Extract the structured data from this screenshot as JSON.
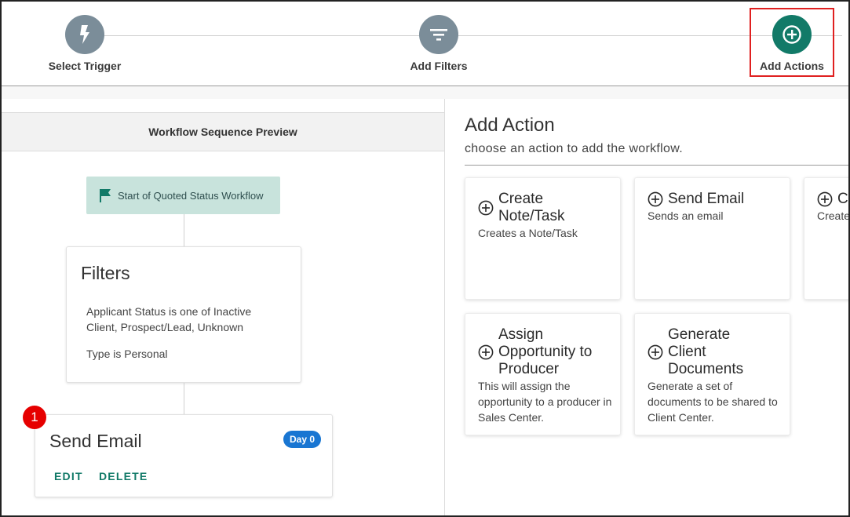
{
  "stepper": {
    "steps": [
      {
        "label": "Select Trigger",
        "icon": "lightning-bolt-icon"
      },
      {
        "label": "Add Filters",
        "icon": "filter-icon"
      },
      {
        "label": "Add Actions",
        "icon": "add-circle-icon"
      }
    ],
    "active_step": "Add Actions",
    "colors": {
      "inactive": "#7b8d99",
      "active": "#127a68",
      "highlight": "#e02020"
    }
  },
  "preview": {
    "header": "Workflow Sequence Preview",
    "start_node": {
      "label": "Start of Quoted Status Workflow",
      "icon": "flag-icon"
    },
    "filters": {
      "title": "Filters",
      "conditions": [
        "Applicant Status is one of Inactive Client, Prospect/Lead, Unknown",
        "Type is Personal"
      ]
    },
    "steps": [
      {
        "number": "1",
        "title": "Send Email",
        "day_badge": "Day 0",
        "edit_label": "EDIT",
        "delete_label": "DELETE"
      }
    ]
  },
  "add_action": {
    "title": "Add Action",
    "subtitle": "choose an action to add the workflow.",
    "cards": [
      {
        "title": "Create Note/Task",
        "description": "Creates a Note/Task"
      },
      {
        "title": "Send Email",
        "description": "Sends an email"
      },
      {
        "title": "Cr",
        "description": "Create"
      },
      {
        "title": "Assign Opportunity to Producer",
        "description": "This will assign the opportunity to a producer in Sales Center."
      },
      {
        "title": "Generate Client Documents",
        "description": "Generate a set of documents to be shared to Client Center."
      }
    ]
  }
}
